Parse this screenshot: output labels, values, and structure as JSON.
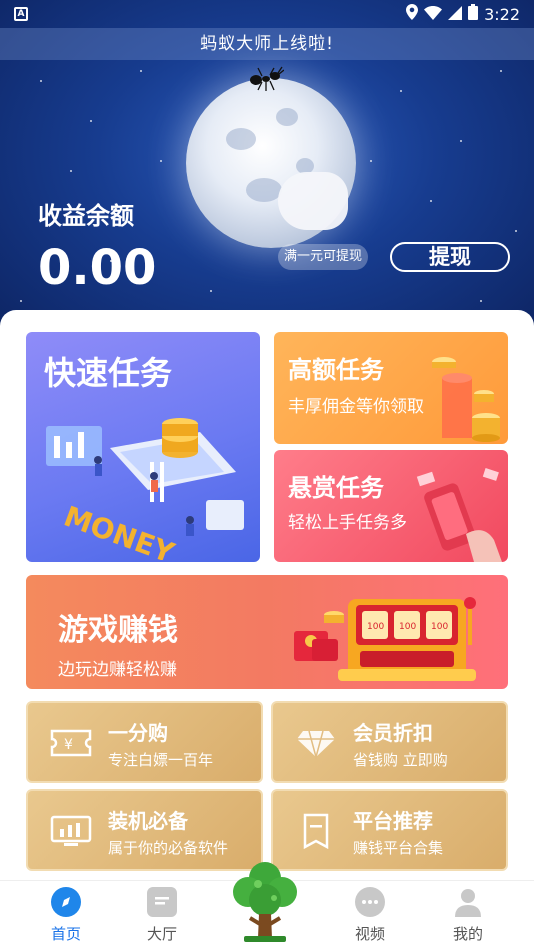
{
  "status_bar": {
    "time": "3:22"
  },
  "notice": {
    "text": "蚂蚁大师上线啦!"
  },
  "balance": {
    "label": "收益余额",
    "value": "0.00",
    "min_tip": "满一元可提现",
    "withdraw_label": "提现"
  },
  "cards": {
    "quick": {
      "title": "快速任务"
    },
    "high": {
      "title": "高额任务",
      "subtitle": "丰厚佣金等你领取"
    },
    "reward": {
      "title": "悬赏任务",
      "subtitle": "轻松上手任务多"
    },
    "game": {
      "title": "游戏赚钱",
      "subtitle": "边玩边赚轻松赚"
    }
  },
  "grid": [
    {
      "title": "一分购",
      "subtitle": "专注白嫖一百年",
      "icon": "ticket-icon"
    },
    {
      "title": "会员折扣",
      "subtitle": "省钱购 立即购",
      "icon": "diamond-icon"
    },
    {
      "title": "装机必备",
      "subtitle": "属于你的必备软件",
      "icon": "monitor-icon"
    },
    {
      "title": "平台推荐",
      "subtitle": "赚钱平台合集",
      "icon": "document-icon"
    }
  ],
  "nav": [
    {
      "label": "首页",
      "active": true
    },
    {
      "label": "大厅",
      "active": false
    },
    {
      "label": "视频",
      "active": false
    },
    {
      "label": "我的",
      "active": false
    }
  ],
  "colors": {
    "nav_active": "#1a73e8",
    "gold_card": "#dfb779",
    "game_card": "#f37a62"
  }
}
